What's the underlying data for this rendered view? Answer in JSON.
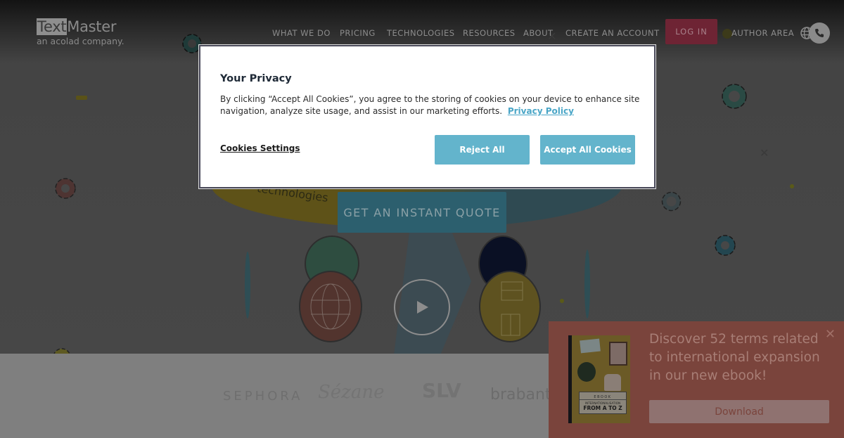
{
  "header": {
    "logo_text_highlight": "Text",
    "logo_text_rest": "Master",
    "logo_tagline": "an acolad company.",
    "nav": [
      {
        "label": "WHAT WE DO"
      },
      {
        "label": "PRICING"
      },
      {
        "label": "TECHNOLOGIES"
      },
      {
        "label": "RESOURCES"
      },
      {
        "label": "ABOUT"
      },
      {
        "label": "CREATE AN ACCOUNT"
      }
    ],
    "login_label": "LOG IN",
    "author_area_label": "AUTHOR AREA",
    "language_icon": "globe-icon",
    "phone_icon": "phone-icon"
  },
  "hero": {
    "illustration_label": "technologies",
    "cta_label": "GET AN INSTANT QUOTE",
    "play_icon": "play-icon"
  },
  "logos": [
    {
      "name": "SEPHORA"
    },
    {
      "name": "Sézane"
    },
    {
      "name": "SLV"
    },
    {
      "name": "brabantia"
    }
  ],
  "cookie_modal": {
    "title": "Your Privacy",
    "body": "By clicking “Accept All Cookies”, you agree to the storing of cookies on your device to enhance site navigation, analyze site usage, and assist in our marketing efforts.",
    "policy_link": "Privacy Policy",
    "settings_label": "Cookies Settings",
    "reject_label": "Reject All",
    "accept_label": "Accept All Cookies",
    "button_color": "#63b4cc"
  },
  "promo": {
    "text": "Discover 52 terms related to international expansion in our new ebook!",
    "download_label": "Download",
    "close_icon": "close-icon",
    "book": {
      "kicker": "EBOOK",
      "subtitle": "INTERNATIONALISATION",
      "title": "FROM A TO Z"
    }
  },
  "colors": {
    "login_bg": "#6e2434",
    "cta_bg": "#2c5f6e",
    "promo_bg": "#7a443c"
  }
}
